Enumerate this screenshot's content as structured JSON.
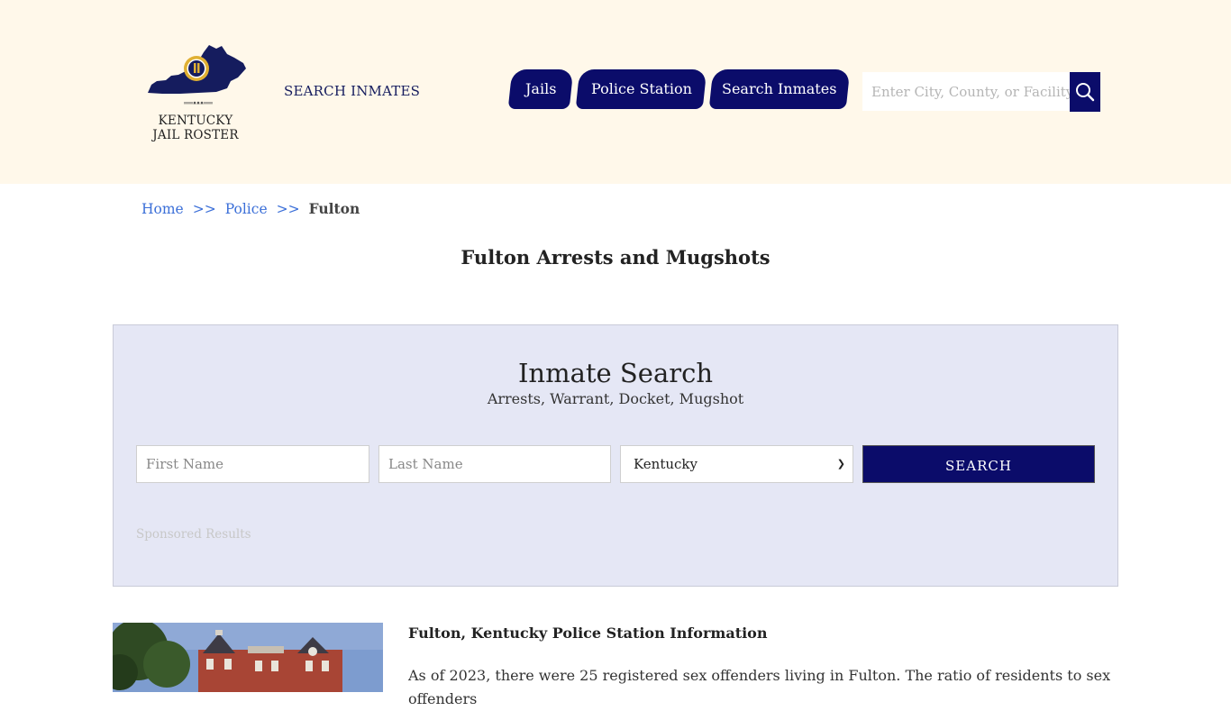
{
  "header": {
    "logo_text_line1": "KENTUCKY",
    "logo_text_line2": "JAIL ROSTER",
    "tagline": "SEARCH INMATES",
    "nav": [
      {
        "label": "Jails"
      },
      {
        "label": "Police Station"
      },
      {
        "label": "Search Inmates"
      }
    ],
    "search": {
      "placeholder": "Enter City, County, or Facility"
    }
  },
  "breadcrumb": {
    "home": "Home",
    "separator": ">>",
    "police": "Police",
    "current": "Fulton"
  },
  "page_title": "Fulton Arrests and Mugshots",
  "inmate_search": {
    "title": "Inmate Search",
    "subtitle": "Arrests, Warrant, Docket, Mugshot",
    "first_name_placeholder": "First Name",
    "last_name_placeholder": "Last Name",
    "state_selected": "Kentucky",
    "search_label": "SEARCH",
    "sponsored": "Sponsored Results"
  },
  "info": {
    "title": "Fulton, Kentucky Police Station Information",
    "text": "As of 2023, there were 25 registered sex offenders living in Fulton. The ratio of residents to sex offenders"
  },
  "colors": {
    "header_bg": "#fff8ea",
    "nav_bg": "#0b0c6a",
    "panel_bg": "#e5e7f5",
    "link": "#3b6fd8"
  }
}
